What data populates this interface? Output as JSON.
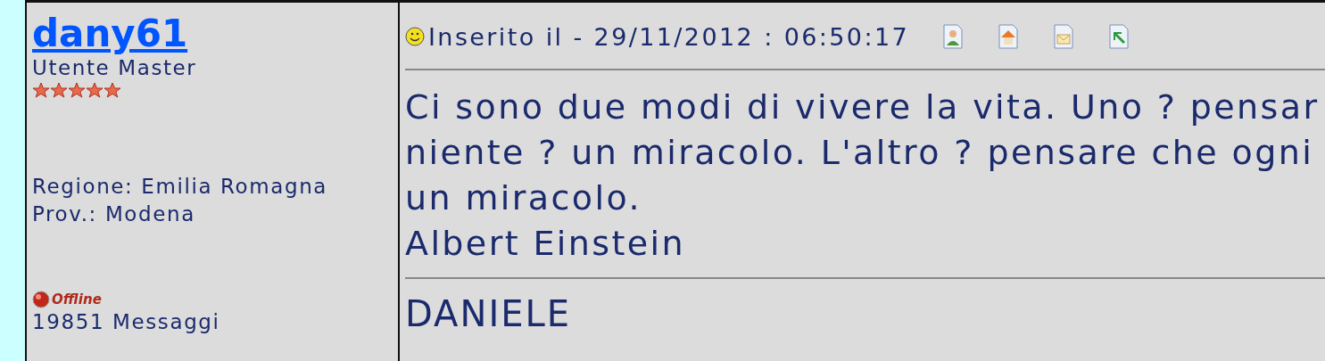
{
  "author": {
    "name": "dany61",
    "rank": "Utente Master",
    "stars": 5,
    "region": "Regione: Emilia Romagna",
    "province": "Prov.: Modena",
    "status": {
      "online": false,
      "label": "Offline"
    },
    "posts": "19851 Messaggi"
  },
  "post": {
    "posted": "Inserito il - 29/11/2012 : 06:50:17",
    "lines": [
      "Ci sono due modi di vivere la vita. Uno ? pensar",
      "niente ? un miracolo. L'altro ? pensare che ogni",
      "un miracolo.",
      "Albert Einstein"
    ],
    "signature": "DANIELE"
  }
}
